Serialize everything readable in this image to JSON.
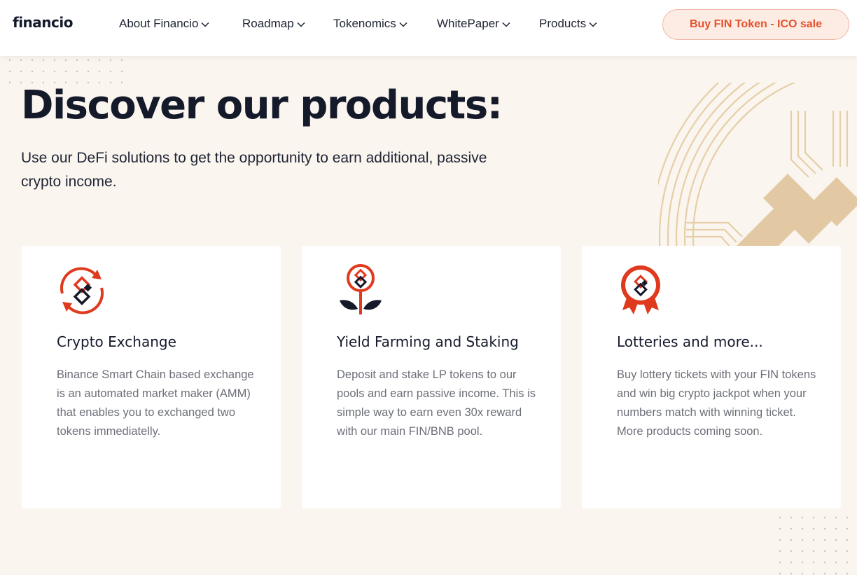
{
  "header": {
    "logo": "financio",
    "nav": [
      {
        "label": "About Financio"
      },
      {
        "label": "Roadmap"
      },
      {
        "label": "Tokenomics"
      },
      {
        "label": "WhitePaper"
      },
      {
        "label": "Products"
      }
    ],
    "cta_label": "Buy FIN Token - ICO sale"
  },
  "hero": {
    "title": "Discover our products:",
    "subtitle": "Use our DeFi solutions to get the opportunity to earn additional, passive crypto income."
  },
  "cards": [
    {
      "icon": "exchange-icon",
      "title": "Crypto Exchange",
      "text": "Binance Smart Chain based exchange is an automated market maker (AMM) that enables you to exchanged two tokens immediatelly."
    },
    {
      "icon": "farming-icon",
      "title": "Yield Farming and Staking",
      "text": "Deposit and stake LP tokens to our pools and earn passive income. This is simple way to earn even 30x reward with our main FIN/BNB pool."
    },
    {
      "icon": "lottery-icon",
      "title": "Lotteries and more...",
      "text": "Buy lottery tickets with your FIN tokens and win big crypto jackpot when your numbers match with winning ticket. More products coming soon."
    }
  ],
  "colors": {
    "accent": "#e03a1e",
    "dark": "#151a2b",
    "background": "#faf5ef",
    "decoration": "#e6cfa8"
  }
}
